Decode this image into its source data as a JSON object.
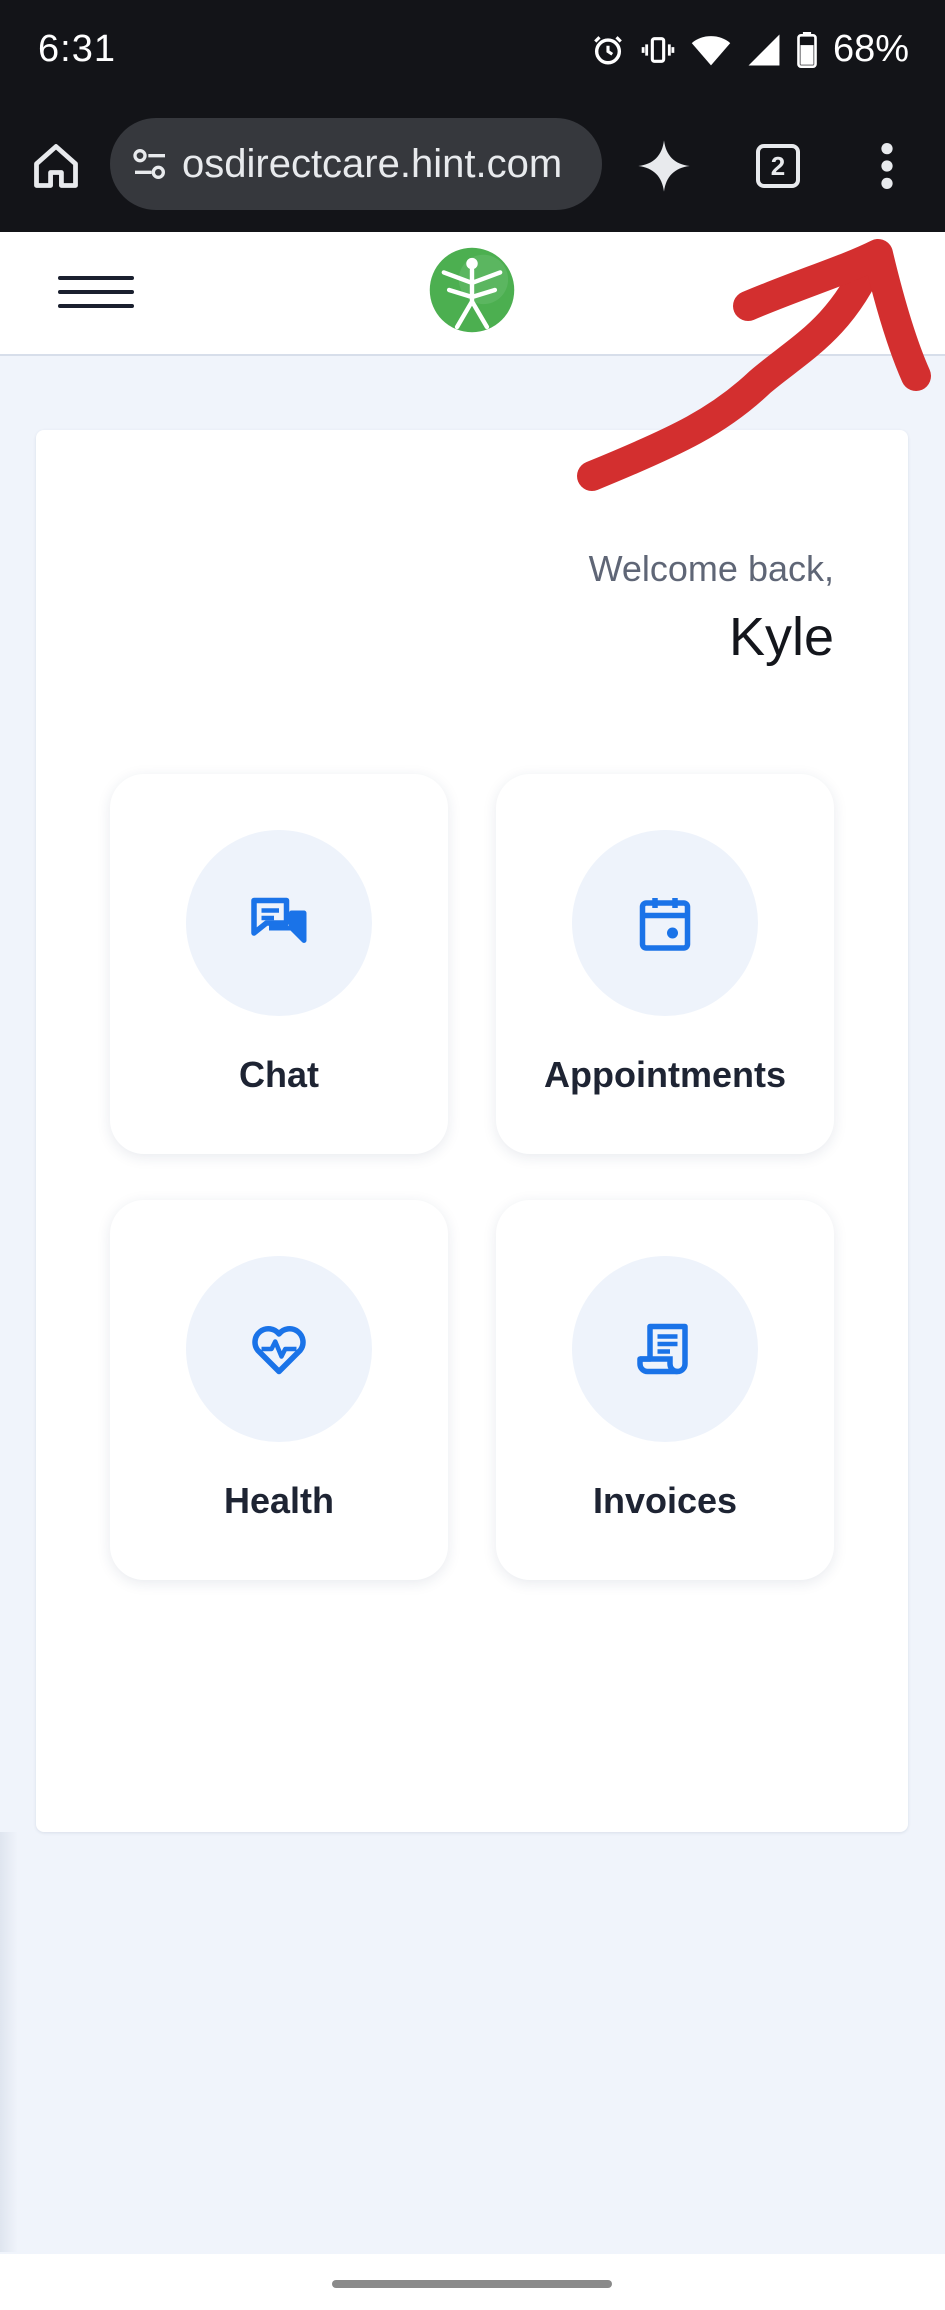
{
  "status_bar": {
    "time": "6:31",
    "battery": "68%",
    "icons": [
      "alarm-icon",
      "vibrate-icon",
      "wifi-icon",
      "signal-icon",
      "battery-icon"
    ]
  },
  "browser": {
    "url": "osdirectcare.hint.com",
    "tab_count": "2",
    "icons": [
      "home-icon",
      "site-settings-icon",
      "sparkle-icon",
      "tabs-icon",
      "more-vert-icon"
    ]
  },
  "app_header": {
    "icons": [
      "hamburger-menu-icon",
      "vitruvian-logo-icon"
    ]
  },
  "welcome": {
    "greeting": "Welcome back,",
    "name": "Kyle"
  },
  "tiles": [
    {
      "label": "Chat",
      "icon": "chat-icon"
    },
    {
      "label": "Appointments",
      "icon": "calendar-icon"
    },
    {
      "label": "Health",
      "icon": "heart-pulse-icon"
    },
    {
      "label": "Invoices",
      "icon": "receipt-icon"
    }
  ],
  "colors": {
    "accent": "#1a73e8",
    "annotation": "#d32f2f",
    "logo_green": "#4caf50"
  }
}
